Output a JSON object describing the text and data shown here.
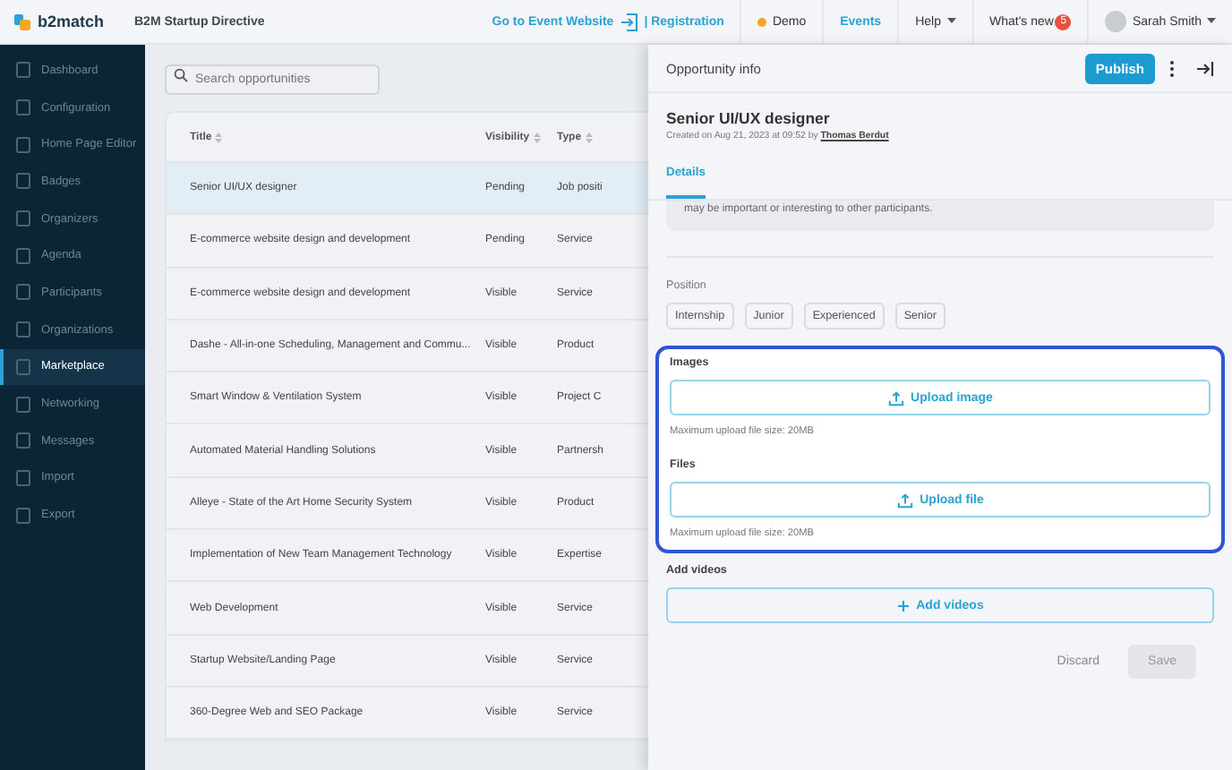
{
  "topbar": {
    "logo": "b2match",
    "event_name": "B2M Startup Directive",
    "event_link": "Go to Event Website",
    "registration_link": "| Registration",
    "demo": {
      "label": "Demo",
      "color": "#f5a623"
    },
    "events": "Events",
    "help": "Help",
    "whats_new": {
      "label": "What's new",
      "badge": "5"
    },
    "user": "Sarah Smith"
  },
  "sidebar": {
    "items": [
      {
        "label": "Dashboard",
        "selected": false
      },
      {
        "label": "Configuration",
        "selected": false
      },
      {
        "label": "Home Page Editor",
        "selected": false
      },
      {
        "label": "Badges",
        "selected": false
      },
      {
        "label": "Organizers",
        "selected": false
      },
      {
        "label": "Agenda",
        "selected": false
      },
      {
        "label": "Participants",
        "selected": false
      },
      {
        "label": "Organizations",
        "selected": false
      },
      {
        "label": "Marketplace",
        "selected": true
      },
      {
        "label": "Networking",
        "selected": false
      },
      {
        "label": "Messages",
        "selected": false
      },
      {
        "label": "Import",
        "selected": false
      },
      {
        "label": "Export",
        "selected": false
      }
    ]
  },
  "search": {
    "placeholder": "Search opportunities"
  },
  "table": {
    "columns": [
      "Title",
      "Visibility",
      "Type"
    ],
    "rows": [
      {
        "cells": [
          "Senior UI/UX designer",
          "Pending",
          "Job positi"
        ],
        "selected": true
      },
      {
        "cells": [
          "E-commerce website design and development",
          "Pending",
          "Service"
        ],
        "selected": false
      },
      {
        "cells": [
          "E-commerce website design and development",
          "Visible",
          "Service"
        ],
        "selected": false
      },
      {
        "cells": [
          "Dashe - All-in-one Scheduling, Management and Commu...",
          "Visible",
          "Product"
        ],
        "selected": false
      },
      {
        "cells": [
          "Smart Window & Ventilation System",
          "Visible",
          "Project C"
        ],
        "selected": false
      },
      {
        "cells": [
          "Automated Material Handling Solutions",
          "Visible",
          "Partnersh"
        ],
        "selected": false
      },
      {
        "cells": [
          "Alleye - State of the Art Home Security System",
          "Visible",
          "Product"
        ],
        "selected": false
      },
      {
        "cells": [
          "Implementation of New Team Management Technology",
          "Visible",
          "Expertise"
        ],
        "selected": false
      },
      {
        "cells": [
          "Web Development",
          "Visible",
          "Service"
        ],
        "selected": false
      },
      {
        "cells": [
          "Startup Website/Landing Page",
          "Visible",
          "Service"
        ],
        "selected": false
      },
      {
        "cells": [
          "360-Degree Web and SEO Package",
          "Visible",
          "Service"
        ],
        "selected": false
      }
    ]
  },
  "panel": {
    "header": "Opportunity info",
    "publish": "Publish",
    "title": "Senior UI/UX designer",
    "created_prefix": "Created on Aug 21, 2023 at 09:52 by",
    "created_by": "Thomas Berdut",
    "tabs": [
      {
        "label": "Details",
        "selected": true
      }
    ],
    "description_tail": "may be important or interesting to other participants.",
    "position": {
      "label": "Position",
      "chips": [
        "Internship",
        "Junior",
        "Experienced",
        "Senior"
      ]
    },
    "images": {
      "label": "Images",
      "button": "Upload image",
      "hint": "Maximum upload file size: 20MB"
    },
    "files": {
      "label": "Files",
      "button": "Upload file",
      "hint": "Maximum upload file size: 20MB"
    },
    "videos": {
      "label": "Add videos",
      "button": "Add videos"
    },
    "discard": "Discard",
    "save": "Save"
  }
}
